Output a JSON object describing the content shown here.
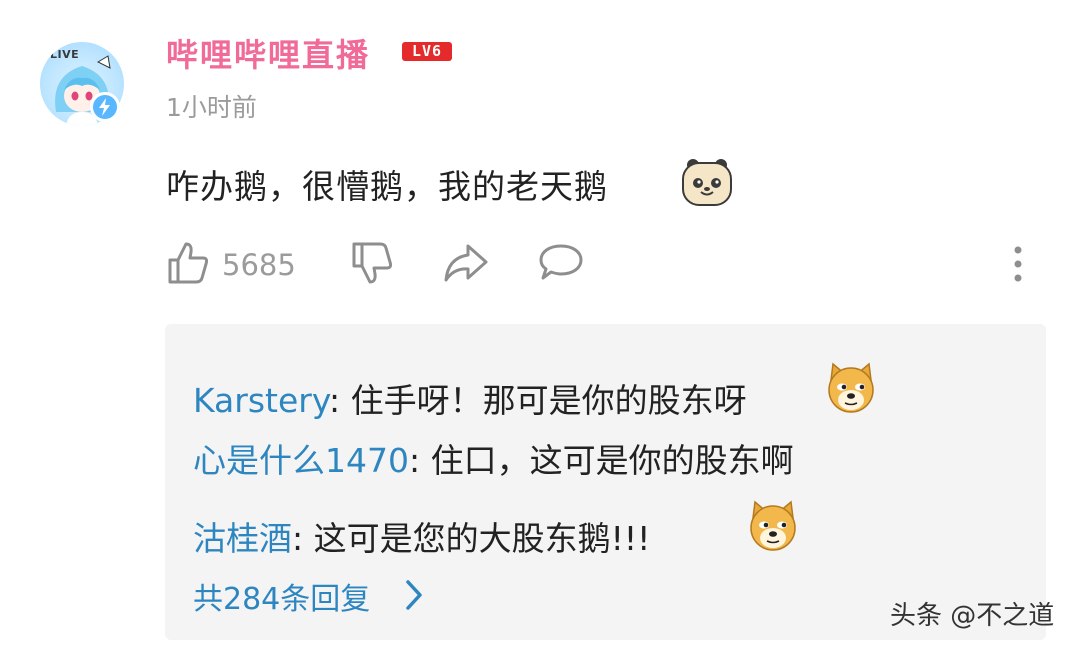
{
  "comment": {
    "author": "哔哩哔哩直播",
    "level_badge": "LV6",
    "avatar_tag": "LIVE",
    "time": "1小时前",
    "text": "咋办鹅，很懵鹅，我的老天鹅",
    "text_emoji": "bear-face-emoji"
  },
  "actions": {
    "like_count": "5685",
    "icons": [
      "thumbs-up-icon",
      "thumbs-down-icon",
      "share-icon",
      "comment-icon",
      "more-vertical-icon"
    ]
  },
  "replies": [
    {
      "name": "Karstery",
      "sep": ": ",
      "text": "住手呀！那可是你的股东呀",
      "emoji": "doge-emoji"
    },
    {
      "name": "心是什么1470",
      "sep": ": ",
      "text": "住口，这可是你的股东啊",
      "emoji": ""
    },
    {
      "name": "沽桂酒",
      "sep": ": ",
      "text": "这可是您的大股东鹅!!!",
      "emoji": "doge-emoji"
    }
  ],
  "more_replies": "共284条回复",
  "watermark": "头条 @不之道",
  "colors": {
    "username": "#f06b97",
    "level_badge": "#e42a2a",
    "reply_name": "#2e86c1",
    "reply_bg": "#f4f4f4"
  }
}
